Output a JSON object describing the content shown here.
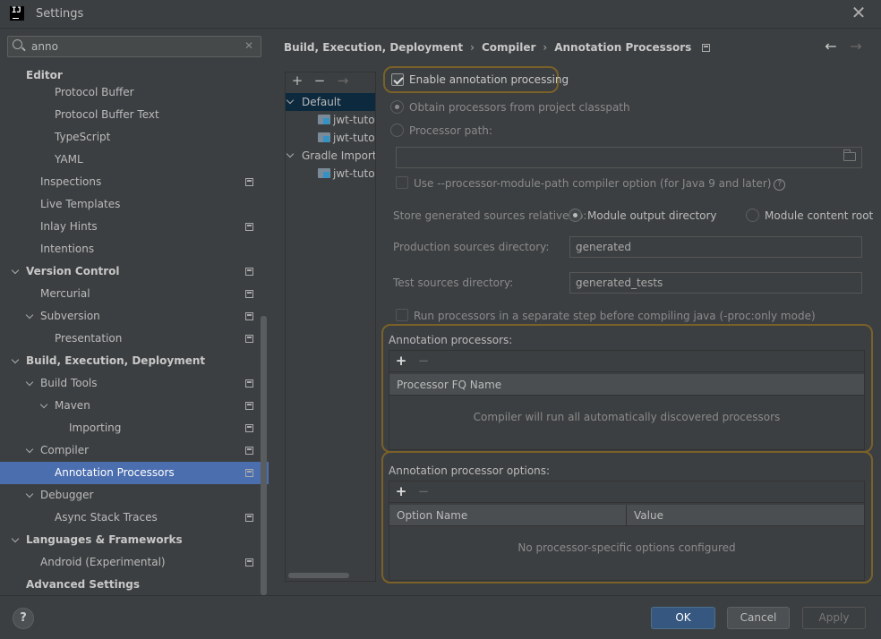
{
  "window": {
    "title": "Settings",
    "app_icon": "intellij-logo",
    "close_icon": "close-icon"
  },
  "search": {
    "value": "anno",
    "placeholder": ""
  },
  "sidebar": {
    "items": [
      {
        "label": "Editor",
        "bold": true
      },
      {
        "label": "Protocol Buffer"
      },
      {
        "label": "Protocol Buffer Text"
      },
      {
        "label": "TypeScript"
      },
      {
        "label": "YAML"
      },
      {
        "label": "Inspections"
      },
      {
        "label": "Live Templates"
      },
      {
        "label": "Inlay Hints"
      },
      {
        "label": "Intentions"
      },
      {
        "label": "Version Control",
        "bold": true
      },
      {
        "label": "Mercurial"
      },
      {
        "label": "Subversion"
      },
      {
        "label": "Presentation"
      },
      {
        "label": "Build, Execution, Deployment",
        "bold": true
      },
      {
        "label": "Build Tools"
      },
      {
        "label": "Maven"
      },
      {
        "label": "Importing"
      },
      {
        "label": "Compiler"
      },
      {
        "label": "Annotation Processors",
        "selected": true
      },
      {
        "label": "Debugger"
      },
      {
        "label": "Async Stack Traces"
      },
      {
        "label": "Languages & Frameworks",
        "bold": true
      },
      {
        "label": "Android (Experimental)"
      },
      {
        "label": "Advanced Settings",
        "bold": true
      }
    ]
  },
  "breadcrumb": [
    "Build, Execution, Deployment",
    "Compiler",
    "Annotation Processors"
  ],
  "profiles": {
    "toolbar": {
      "add": "+",
      "remove": "−",
      "move": "→"
    },
    "items": [
      {
        "label": "Default",
        "selected": true
      },
      {
        "label": "jwt-tutorial"
      },
      {
        "label": "jwt-tutorial"
      },
      {
        "label": "Gradle Imported"
      },
      {
        "label": "jwt-tutorial"
      }
    ]
  },
  "settings": {
    "enable_label": "Enable annotation processing",
    "enable_checked": true,
    "obtain_label": "Obtain processors from project classpath",
    "path_label": "Processor path:",
    "path_value": "",
    "module_path_label": "Use --processor-module-path compiler option (for Java 9 and later)",
    "store_label": "Store generated sources relative to:",
    "module_output_label": "Module output directory",
    "module_content_label": "Module content root",
    "prod_label": "Production sources directory:",
    "prod_value": "generated",
    "test_label": "Test sources directory:",
    "test_value": "generated_tests",
    "run_separate_label": "Run processors in a separate step before compiling java (-proc:only mode)"
  },
  "annotation_processors": {
    "title": "Annotation processors:",
    "add": "+",
    "remove": "−",
    "column": "Processor FQ Name",
    "empty": "Compiler will run all automatically discovered processors"
  },
  "processor_options": {
    "title": "Annotation processor options:",
    "add": "+",
    "remove": "−",
    "columns": [
      "Option Name",
      "Value"
    ],
    "empty": "No processor-specific options configured"
  },
  "footer": {
    "help": "?",
    "ok": "OK",
    "cancel": "Cancel",
    "apply": "Apply"
  },
  "colors": {
    "selection": "#4b6eaf",
    "highlight_border": "#7a6128",
    "ok_button": "#365880"
  }
}
